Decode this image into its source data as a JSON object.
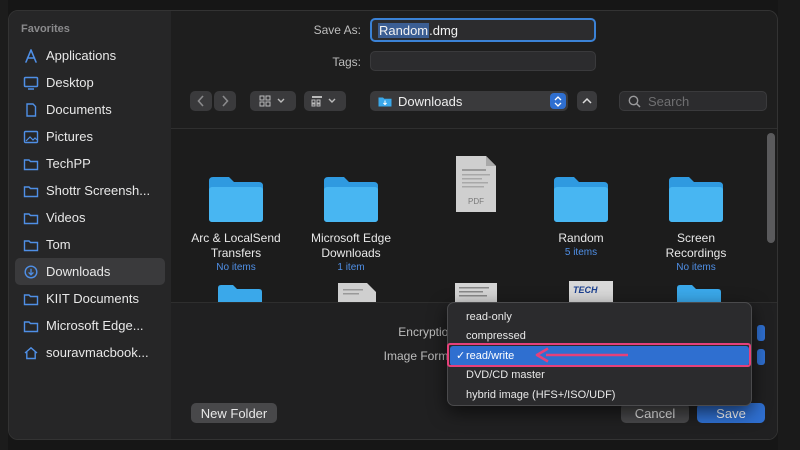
{
  "colors": {
    "accent": "#2f6fd0",
    "folder": "#3aa8ea",
    "highlight": "#e6407a",
    "link": "#4f8fe6"
  },
  "sidebar": {
    "heading": "Favorites",
    "items": [
      {
        "label": "Applications",
        "icon": "applications-icon"
      },
      {
        "label": "Desktop",
        "icon": "desktop-icon"
      },
      {
        "label": "Documents",
        "icon": "document-icon"
      },
      {
        "label": "Pictures",
        "icon": "pictures-icon"
      },
      {
        "label": "TechPP",
        "icon": "folder-icon"
      },
      {
        "label": "Shottr Screensh...",
        "icon": "folder-icon"
      },
      {
        "label": "Videos",
        "icon": "folder-icon"
      },
      {
        "label": "Tom",
        "icon": "folder-icon"
      },
      {
        "label": "Downloads",
        "icon": "downloads-icon",
        "active": true
      },
      {
        "label": "KIIT Documents",
        "icon": "folder-icon"
      },
      {
        "label": "Microsoft Edge...",
        "icon": "folder-icon"
      },
      {
        "label": "souravmacbook...",
        "icon": "home-icon"
      }
    ]
  },
  "save_as": {
    "label": "Save As:",
    "value_selected": "Random",
    "value_rest": ".dmg"
  },
  "tags": {
    "label": "Tags:"
  },
  "toolbar": {
    "location": "Downloads",
    "search_placeholder": "Search"
  },
  "files": [
    {
      "name_line1": "Arc & LocalSend",
      "name_line2": "Transfers",
      "sub": "No items",
      "kind": "folder"
    },
    {
      "name_line1": "Microsoft Edge",
      "name_line2": "Downloads",
      "sub": "1 item",
      "kind": "folder"
    },
    {
      "name_line1": "",
      "name_line2": "",
      "sub": "",
      "kind": "pdf",
      "badge": "PDF"
    },
    {
      "name_line1": "Random",
      "name_line2": "",
      "sub": "5 items",
      "kind": "folder"
    },
    {
      "name_line1": "Screen",
      "name_line2": "Recordings",
      "sub": "No items",
      "kind": "folder"
    }
  ],
  "partial_badge": "TECH",
  "options": {
    "encryption_label": "Encryption",
    "image_format_label": "Image Forma"
  },
  "menu": {
    "items": [
      "read-only",
      "compressed",
      "read/write",
      "DVD/CD master",
      "hybrid image (HFS+/ISO/UDF)"
    ],
    "selected_index": 2,
    "check": "✓"
  },
  "buttons": {
    "new_folder": "New Folder",
    "cancel": "Cancel",
    "save": "Save"
  }
}
